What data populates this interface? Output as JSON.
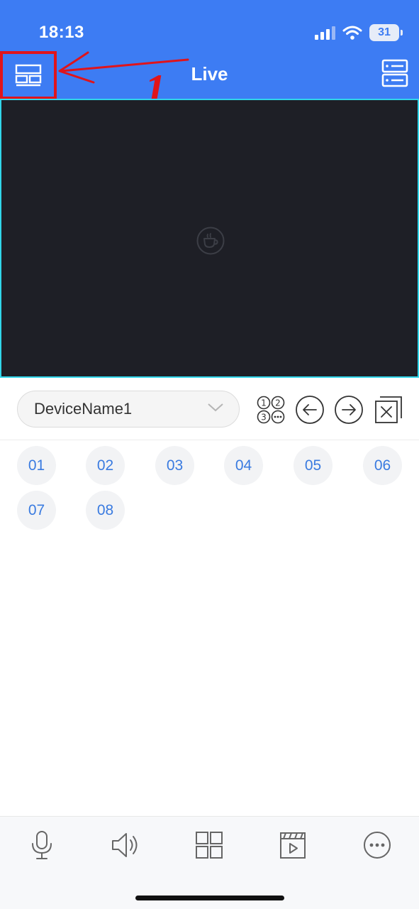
{
  "status_bar": {
    "time": "18:13",
    "battery": "31",
    "icons": [
      "cellular-signal-icon",
      "wifi-icon",
      "battery-icon"
    ]
  },
  "header": {
    "title": "Live",
    "left_icon": "layout-split-icon",
    "right_icon": "device-list-icon",
    "annotation_label": "1"
  },
  "video": {
    "placeholder_icon": "coffee-cup-icon"
  },
  "controls": {
    "device_name": "DeviceName1",
    "icons": [
      "channel-numbers-icon",
      "arrow-left-circle-icon",
      "arrow-right-circle-icon",
      "close-all-icon"
    ]
  },
  "channels": [
    "01",
    "02",
    "03",
    "04",
    "05",
    "06",
    "07",
    "08"
  ],
  "toolbar": {
    "icons": [
      "microphone-icon",
      "speaker-icon",
      "grid-icon",
      "playback-clapper-icon",
      "more-icon"
    ]
  },
  "colors": {
    "header_bg": "#3d7cf3",
    "video_bg": "#1e1f26",
    "video_border": "#31d5ea",
    "annotation": "#e0141b",
    "channel_text": "#3a7be0"
  }
}
